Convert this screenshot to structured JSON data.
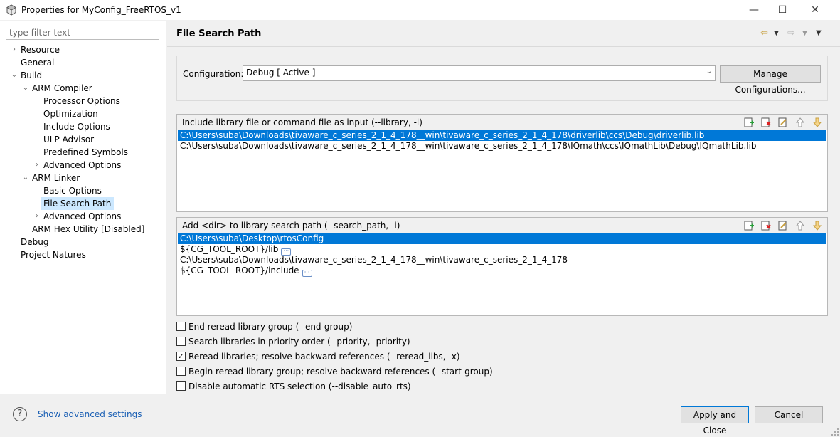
{
  "window": {
    "title": "Properties for MyConfig_FreeRTOS_v1",
    "minimize_glyph": "—",
    "maximize_glyph": "☐",
    "close_glyph": "✕"
  },
  "sidebar": {
    "filter_placeholder": "type filter text",
    "tree": [
      {
        "label": "Resource",
        "level": 0,
        "arrow": "›"
      },
      {
        "label": "General",
        "level": 0,
        "arrow": ""
      },
      {
        "label": "Build",
        "level": 0,
        "arrow": "⌄"
      },
      {
        "label": "ARM Compiler",
        "level": 1,
        "arrow": "⌄"
      },
      {
        "label": "Processor Options",
        "level": 2,
        "arrow": ""
      },
      {
        "label": "Optimization",
        "level": 2,
        "arrow": ""
      },
      {
        "label": "Include Options",
        "level": 2,
        "arrow": ""
      },
      {
        "label": "ULP Advisor",
        "level": 2,
        "arrow": ""
      },
      {
        "label": "Predefined Symbols",
        "level": 2,
        "arrow": ""
      },
      {
        "label": "Advanced Options",
        "level": 2,
        "arrow": "›"
      },
      {
        "label": "ARM Linker",
        "level": 1,
        "arrow": "⌄"
      },
      {
        "label": "Basic Options",
        "level": 2,
        "arrow": ""
      },
      {
        "label": "File Search Path",
        "level": 2,
        "arrow": "",
        "selected": true
      },
      {
        "label": "Advanced Options",
        "level": 2,
        "arrow": "›"
      },
      {
        "label": "ARM Hex Utility  [Disabled]",
        "level": 1,
        "arrow": ""
      },
      {
        "label": "Debug",
        "level": 0,
        "arrow": ""
      },
      {
        "label": "Project Natures",
        "level": 0,
        "arrow": ""
      }
    ]
  },
  "main": {
    "title": "File Search Path",
    "configuration": {
      "label": "Configuration:",
      "value": "Debug  [ Active ]",
      "manage_button": "Manage Configurations..."
    },
    "library_list": {
      "header": "Include library file or command file as input (--library, -l)",
      "items": [
        "C:\\Users\\suba\\Downloads\\tivaware_c_series_2_1_4_178__win\\tivaware_c_series_2_1_4_178\\driverlib\\ccs\\Debug\\driverlib.lib",
        "C:\\Users\\suba\\Downloads\\tivaware_c_series_2_1_4_178__win\\tivaware_c_series_2_1_4_178\\IQmath\\ccs\\IQmathLib\\Debug\\IQmathLib.lib"
      ]
    },
    "search_path_list": {
      "header": "Add <dir> to library search path (--search_path, -i)",
      "items": [
        "C:\\Users\\suba\\Desktop\\rtosConfig",
        "${CG_TOOL_ROOT}/lib",
        "C:\\Users\\suba\\Downloads\\tivaware_c_series_2_1_4_178__win\\tivaware_c_series_2_1_4_178",
        "${CG_TOOL_ROOT}/include"
      ]
    },
    "options": [
      {
        "label": "End reread library group (--end-group)",
        "checked": false
      },
      {
        "label": "Search libraries in priority order (--priority, -priority)",
        "checked": false
      },
      {
        "label": "Reread libraries; resolve backward references (--reread_libs, -x)",
        "checked": true
      },
      {
        "label": "Begin reread library group; resolve backward references (--start-group)",
        "checked": false
      },
      {
        "label": "Disable automatic RTS selection (--disable_auto_rts)",
        "checked": false
      }
    ]
  },
  "footer": {
    "help_glyph": "?",
    "advanced_link": "Show advanced settings",
    "apply_button": "Apply and Close",
    "cancel_button": "Cancel"
  }
}
